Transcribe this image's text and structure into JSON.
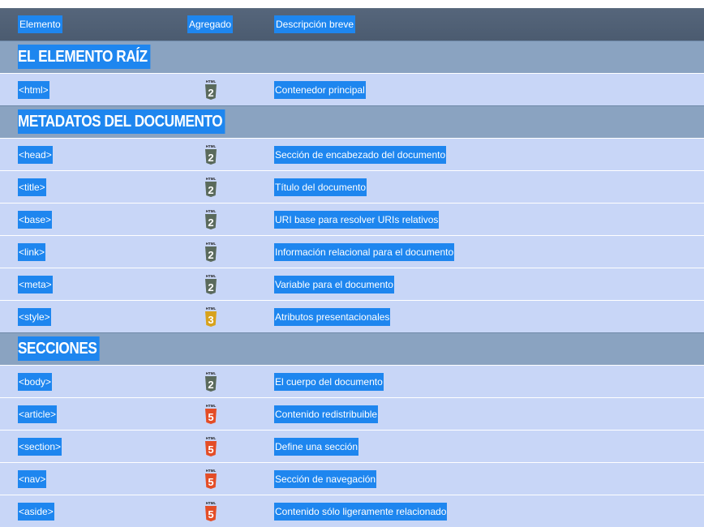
{
  "header": {
    "col_element": "Elemento",
    "col_added": "Agregado",
    "col_description": "Descripción breve"
  },
  "sections": [
    {
      "title": "EL ELEMENTO RAÍZ",
      "rows": [
        {
          "element": "<html>",
          "version": "2",
          "description": "Contenedor principal"
        }
      ]
    },
    {
      "title": "METADATOS DEL DOCUMENTO",
      "rows": [
        {
          "element": "<head>",
          "version": "2",
          "description": "Sección de encabezado del documento"
        },
        {
          "element": "<title>",
          "version": "2",
          "description": "Título del documento"
        },
        {
          "element": "<base>",
          "version": "2",
          "description": "URI base para resolver URIs relativos"
        },
        {
          "element": "<link>",
          "version": "2",
          "description": "Información relacional para el documento"
        },
        {
          "element": "<meta>",
          "version": "2",
          "description": "Variable para el documento"
        },
        {
          "element": "<style>",
          "version": "3",
          "description": "Atributos presentacionales"
        }
      ]
    },
    {
      "title": "SECCIONES",
      "rows": [
        {
          "element": "<body>",
          "version": "2",
          "description": "El cuerpo del documento"
        },
        {
          "element": "<article>",
          "version": "5",
          "description": "Contenido redistribuible"
        },
        {
          "element": "<section>",
          "version": "5",
          "description": "Define una sección"
        },
        {
          "element": "<nav>",
          "version": "5",
          "description": "Sección de navegación"
        },
        {
          "element": "<aside>",
          "version": "5",
          "description": "Contenido sólo ligeramente relacionado"
        }
      ]
    }
  ],
  "badge_label": "HTML",
  "badge_colors": {
    "2": "#5a6a5c",
    "3": "#d8a21c",
    "5": "#e44d26"
  }
}
